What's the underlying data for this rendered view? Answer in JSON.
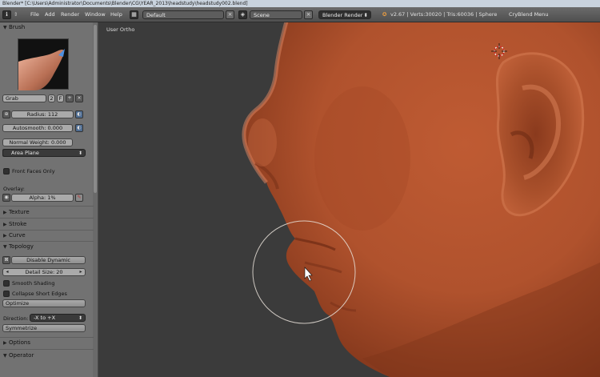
{
  "window": {
    "title": "Blender* [C:\\Users\\Administrator\\Documents\\Blender\\CG\\YEAR_2013\\headstudy\\headstudy002.blend]"
  },
  "topbar": {
    "menus": [
      "File",
      "Add",
      "Render",
      "Window",
      "Help"
    ],
    "screen_layout": "Default",
    "scene": "Scene",
    "render_engine": "Blender Render",
    "stats": "v2.67 | Verts:30020 | Tris:60036 | Sphere",
    "cryblend_menu": "CryBlend Menu"
  },
  "toolshelf": {
    "brush_header": "Brush",
    "brush_name": "Grab",
    "brush_users": "2",
    "brush_fake_user": "F",
    "radius_label": "Radius: 112",
    "autosmooth_label": "Autosmooth: 0.000",
    "normal_weight_label": "Normal Weight: 0.000",
    "sculpt_plane": "Area Plane",
    "front_faces_only": "Front Faces Only",
    "overlay_label": "Overlay:",
    "alpha_label": "Alpha: 1%",
    "texture_header": "Texture",
    "stroke_header": "Stroke",
    "curve_header": "Curve",
    "topology_header": "Topology",
    "disable_dynamic": "Disable Dynamic",
    "detail_size_label": "Detail Size: 20",
    "smooth_shading": "Smooth Shading",
    "collapse_short_edges": "Collapse Short Edges",
    "optimize": "Optimize",
    "direction_label": "Direction:",
    "direction_value": "-X to +X",
    "symmetrize": "Symmetrize",
    "options_header": "Options",
    "operator_header": "Operator"
  },
  "viewport": {
    "view_label": "User Ortho"
  },
  "colors": {
    "skin": "#b5552f",
    "panel": "#727272",
    "viewport_bg": "#3b3b3b",
    "accent_blue": "#4f6d92"
  }
}
